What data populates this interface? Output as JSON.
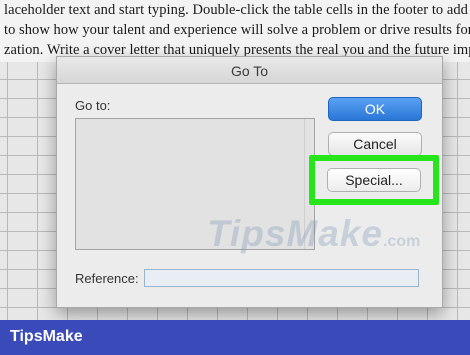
{
  "document": {
    "lines": [
      "laceholder text and start typing. Double-click the table cells in the footer to add you",
      "to show how your talent and experience will solve a problem or drive results for you",
      "zation. Write a cover letter that uniquely presents the real you and the future impact"
    ]
  },
  "dialog": {
    "title": "Go To",
    "goto_label": "Go to:",
    "reference_label": "Reference:",
    "reference_value": "",
    "ok_label": "OK",
    "cancel_label": "Cancel",
    "special_label": "Special..."
  },
  "watermark": {
    "text": "TipsMake",
    "suffix": ".com"
  },
  "footer": {
    "brand": "TipsMake"
  },
  "colors": {
    "highlight": "#27e51b",
    "ok_button": "#2a76d6",
    "brand_bar": "#3a4ab9"
  }
}
